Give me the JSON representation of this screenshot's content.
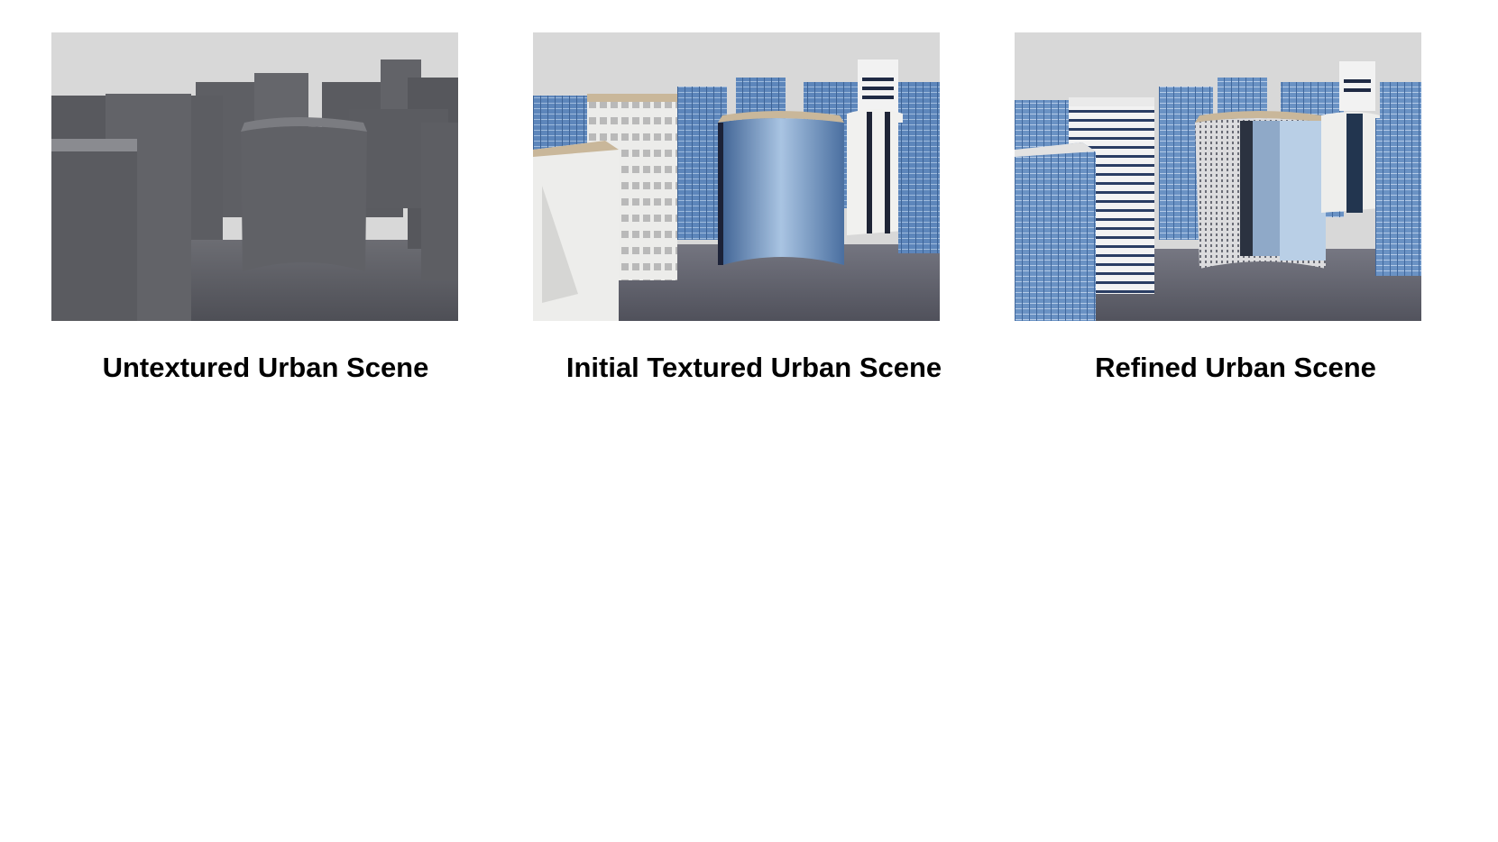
{
  "figure": {
    "panels": [
      {
        "caption": "Untextured Urban Scene",
        "image": "untextured-urban-scene-render"
      },
      {
        "caption": "Initial Textured Urban Scene",
        "image": "initial-textured-urban-scene-render"
      },
      {
        "caption": "Refined Urban Scene",
        "image": "refined-urban-scene-render"
      }
    ]
  },
  "colors": {
    "sky": "#d6d6d6",
    "ground": "#5f6068",
    "untextured_building": "#5d5e63",
    "glass": "#5b82b8",
    "facade_white": "#e8e8e6",
    "caption_text": "#000000"
  }
}
